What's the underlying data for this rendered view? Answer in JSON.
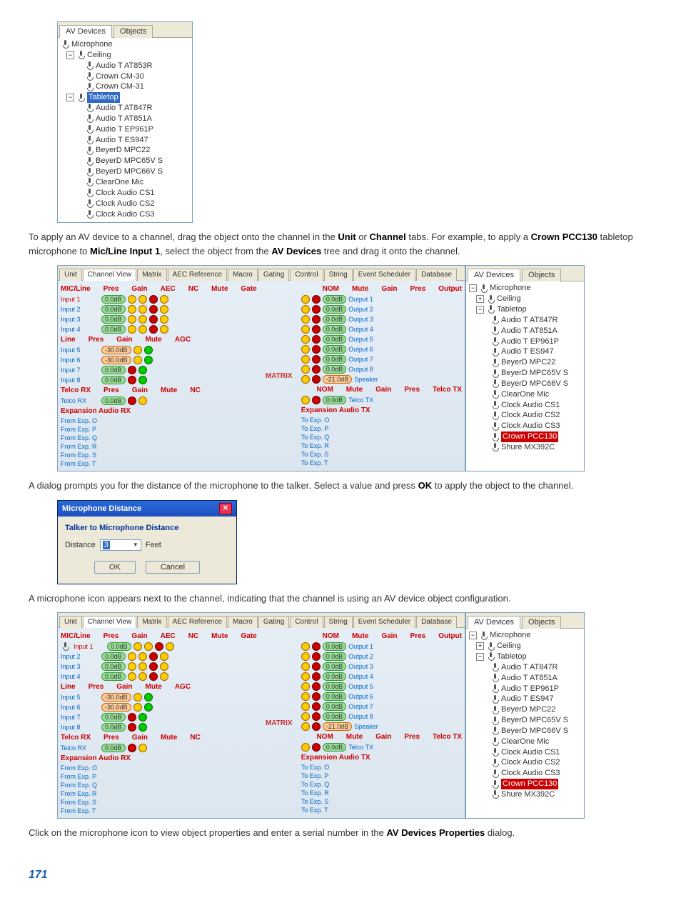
{
  "tree1": {
    "tabs": {
      "av": "AV Devices",
      "obj": "Objects"
    },
    "root": "Microphone",
    "cat1": "Ceiling",
    "ceiling_items": [
      "Audio T AT853R",
      "Crown CM-30",
      "Crown CM-31"
    ],
    "cat2": "Tabletop",
    "tabletop_items": [
      "Audio T AT847R",
      "Audio T AT851A",
      "Audio T EP961P",
      "Audio T ES947",
      "BeyerD MPC22",
      "BeyerD MPC65V S",
      "BeyerD MPC66V S",
      "ClearOne Mic",
      "Clock Audio CS1",
      "Clock Audio CS2",
      "Clock Audio CS3"
    ]
  },
  "para1_a": "To apply an AV device to a channel, drag the object onto the channel in the ",
  "para1_b": "Unit",
  "para1_c": " or ",
  "para1_d": "Channel",
  "para1_e": " tabs. For example, to apply a ",
  "para1_f": "Crown PCC130",
  "para1_g": " tabletop microphone to ",
  "para1_h": "Mic/Line Input 1",
  "para1_i": ", select the object from the ",
  "para1_j": "AV Devices",
  "para1_k": " tree and drag it onto the channel.",
  "mixer": {
    "tabs": [
      "Unit",
      "Channel View",
      "Matrix",
      "AEC Reference",
      "Macro",
      "Gating",
      "Control",
      "String",
      "Event Scheduler",
      "Database"
    ],
    "section_micline": "MIC/Line",
    "section_line": "Line",
    "section_telco": "Telco RX",
    "section_exp": "Expansion Audio RX",
    "col_labels": [
      "Pres",
      "Gain",
      "AEC",
      "NC",
      "Mute",
      "Gate"
    ],
    "col_labels2": [
      "Mute",
      "AGC"
    ],
    "col_labels3": [
      "Mute",
      "NC"
    ],
    "out_labels": [
      "NOM",
      "Mute",
      "Gain",
      "Pres",
      "Output"
    ],
    "inputs_mic": [
      "Input 1",
      "Input 2",
      "Input 3",
      "Input 4"
    ],
    "inputs_line": [
      "Input 5",
      "Input 6",
      "Input 7",
      "Input 8"
    ],
    "telco_row": "Telco RX",
    "exp_rows": [
      "From Exp. O",
      "From Exp. P",
      "From Exp. Q",
      "From Exp. R",
      "From Exp. S",
      "From Exp. T"
    ],
    "gain_mic": [
      "0.0dB",
      "0.0dB",
      "0.0dB",
      "0.0dB"
    ],
    "gain_line": [
      "-30.0dB",
      "-30.0dB",
      "0.0dB",
      "0.0dB"
    ],
    "gain_telco": "0.0dB",
    "outputs": [
      "Output 1",
      "Output 2",
      "Output 3",
      "Output 4",
      "Output 5",
      "Output 6",
      "Output 7",
      "Output 8",
      "Speaker",
      "Telco TX",
      "Telco TX"
    ],
    "out_gain": [
      "0.0dB",
      "0.0dB",
      "0.0dB",
      "0.0dB",
      "0.0dB",
      "0.0dB",
      "0.0dB",
      "0.0dB",
      "-21.0dB",
      "0.0dB"
    ],
    "exp_out_label": "Expansion Audio TX",
    "exp_outs": [
      "To Exp. O",
      "To Exp. P",
      "To Exp. Q",
      "To Exp. R",
      "To Exp. S",
      "To Exp. T"
    ],
    "matrix_label": "MATRIX",
    "side_tree": {
      "root": "Microphone",
      "ceiling": "Ceiling",
      "tabletop": "Tabletop",
      "items": [
        "Audio T AT847R",
        "Audio T AT851A",
        "Audio T EP961P",
        "Audio T ES947",
        "BeyerD MPC22",
        "BeyerD MPC65V S",
        "BeyerD MPC66V S",
        "ClearOne Mic",
        "Clock Audio CS1",
        "Clock Audio CS2",
        "Clock Audio CS3",
        "Crown PCC130",
        "Shure MX392C"
      ]
    }
  },
  "para2_a": "A dialog prompts you for the distance of the microphone to the talker. Select a value and press ",
  "para2_b": "OK",
  "para2_c": " to apply the object to the channel.",
  "dialog": {
    "title": "Microphone Distance",
    "group": "Talker to Microphone Distance",
    "field_label": "Distance",
    "value": "3",
    "unit": "Feet",
    "ok": "OK",
    "cancel": "Cancel"
  },
  "para3": "A microphone icon appears next to the channel, indicating that the channel is using an AV device object configuration.",
  "para4_a": "Click on the microphone icon to view object properties and enter a serial number in the ",
  "para4_b": "AV Devices Properties",
  "para4_c": " dialog.",
  "page_num": "171"
}
